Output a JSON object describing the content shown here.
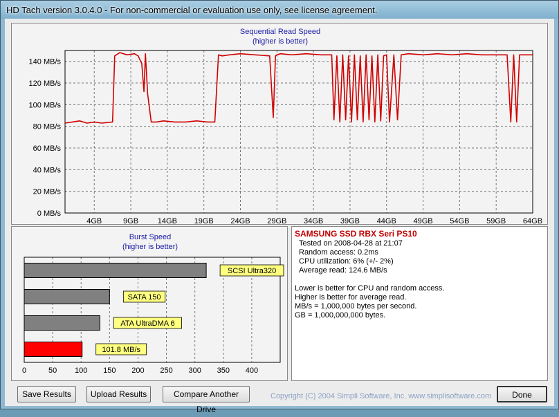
{
  "window": {
    "title": "HD Tach version 3.0.4.0  - For non-commercial or evaluation use only, see license agreement."
  },
  "sequential": {
    "title_line1": "Sequential Read Speed",
    "title_line2": "(higher is better)"
  },
  "burst": {
    "title_line1": "Burst Speed",
    "title_line2": "(higher is better)"
  },
  "info": {
    "drive_name": "SAMSUNG SSD RBX Seri PS10",
    "tested_on": "Tested on 2008-04-28 at 21:07",
    "random_access": "Random access: 0.2ms",
    "cpu_utilization": "CPU utilization: 6% (+/- 2%)",
    "average_read": "Average read: 124.6 MB/s",
    "note1": "Lower is better for CPU and random access.",
    "note2": "Higher is better for average read.",
    "note3": "MB/s = 1,000,000 bytes per second.",
    "note4": "GB = 1,000,000,000 bytes."
  },
  "buttons": {
    "save": "Save Results",
    "upload": "Upload Results",
    "compare": "Compare Another Drive",
    "done": "Done"
  },
  "footer": {
    "copyright": "Copyright (C) 2004 Simpli Software, Inc. www.simplisoftware.com"
  },
  "chart_data": [
    {
      "type": "line",
      "title": "Sequential Read Speed",
      "subtitle": "(higher is better)",
      "y_unit": "MB/s",
      "ylim": [
        0,
        150
      ],
      "y_ticks": [
        "0 MB/s",
        "20 MB/s",
        "40 MB/s",
        "60 MB/s",
        "80 MB/s",
        "100 MB/s",
        "120 MB/s",
        "140 MB/s"
      ],
      "y_tick_values": [
        0,
        20,
        40,
        60,
        80,
        100,
        120,
        140
      ],
      "x_ticks": [
        "4GB",
        "9GB",
        "14GB",
        "19GB",
        "24GB",
        "29GB",
        "34GB",
        "39GB",
        "44GB",
        "49GB",
        "54GB",
        "59GB",
        "64GB"
      ],
      "x_tick_values": [
        4,
        9,
        14,
        19,
        24,
        29,
        34,
        39,
        44,
        49,
        54,
        59,
        64
      ],
      "xlim": [
        0,
        64
      ],
      "grid": true,
      "color": "#d00000",
      "series": [
        {
          "x": [
            0,
            1,
            2,
            3,
            4,
            5,
            6.5,
            6.8,
            7.5,
            8.5,
            9.5,
            10,
            10.5,
            10.8,
            11,
            11.3,
            11.8,
            12.5,
            13.5,
            15,
            16.5,
            18,
            19.5,
            20.5,
            21,
            21.5,
            22.5,
            24,
            26,
            28,
            28.5,
            28.8,
            29,
            29.5,
            31,
            33,
            35,
            36.5,
            36.8,
            37.2,
            37.6,
            38,
            38.4,
            38.8,
            39.2,
            39.6,
            40,
            40.4,
            40.8,
            41.2,
            41.6,
            42,
            42.4,
            42.8,
            43.2,
            43.6,
            44,
            44.4,
            45,
            45.5,
            46,
            47,
            49,
            51,
            53,
            55,
            57,
            59,
            60.5,
            61,
            61.4,
            61.8,
            62.2,
            63,
            64
          ],
          "y": [
            83,
            84,
            85,
            83,
            84,
            83,
            84,
            145,
            148,
            146,
            147,
            145,
            138,
            112,
            147,
            110,
            84,
            84,
            85,
            84,
            84,
            85,
            84,
            84,
            146,
            145,
            146,
            147,
            146,
            145,
            88,
            145,
            146,
            147,
            146,
            147,
            146,
            146,
            86,
            145,
            84,
            146,
            86,
            145,
            84,
            146,
            86,
            145,
            84,
            146,
            86,
            145,
            84,
            146,
            85,
            145,
            146,
            84,
            146,
            86,
            146,
            147,
            146,
            147,
            146,
            147,
            146,
            146,
            146,
            84,
            146,
            84,
            146,
            146,
            146
          ]
        }
      ]
    },
    {
      "type": "bar",
      "title": "Burst Speed",
      "subtitle": "(higher is better)",
      "orientation": "horizontal",
      "xlim": [
        0,
        450
      ],
      "x_ticks": [
        0,
        50,
        100,
        150,
        200,
        250,
        300,
        350,
        400
      ],
      "grid": true,
      "categories": [
        "SCSI Ultra320",
        "SATA 150",
        "ATA UltraDMA 6",
        "101.8 MB/s"
      ],
      "values": [
        320,
        150,
        133,
        101.8
      ],
      "colors": [
        "#808080",
        "#808080",
        "#808080",
        "#ff0000"
      ],
      "label_bg": "#ffff80"
    }
  ]
}
